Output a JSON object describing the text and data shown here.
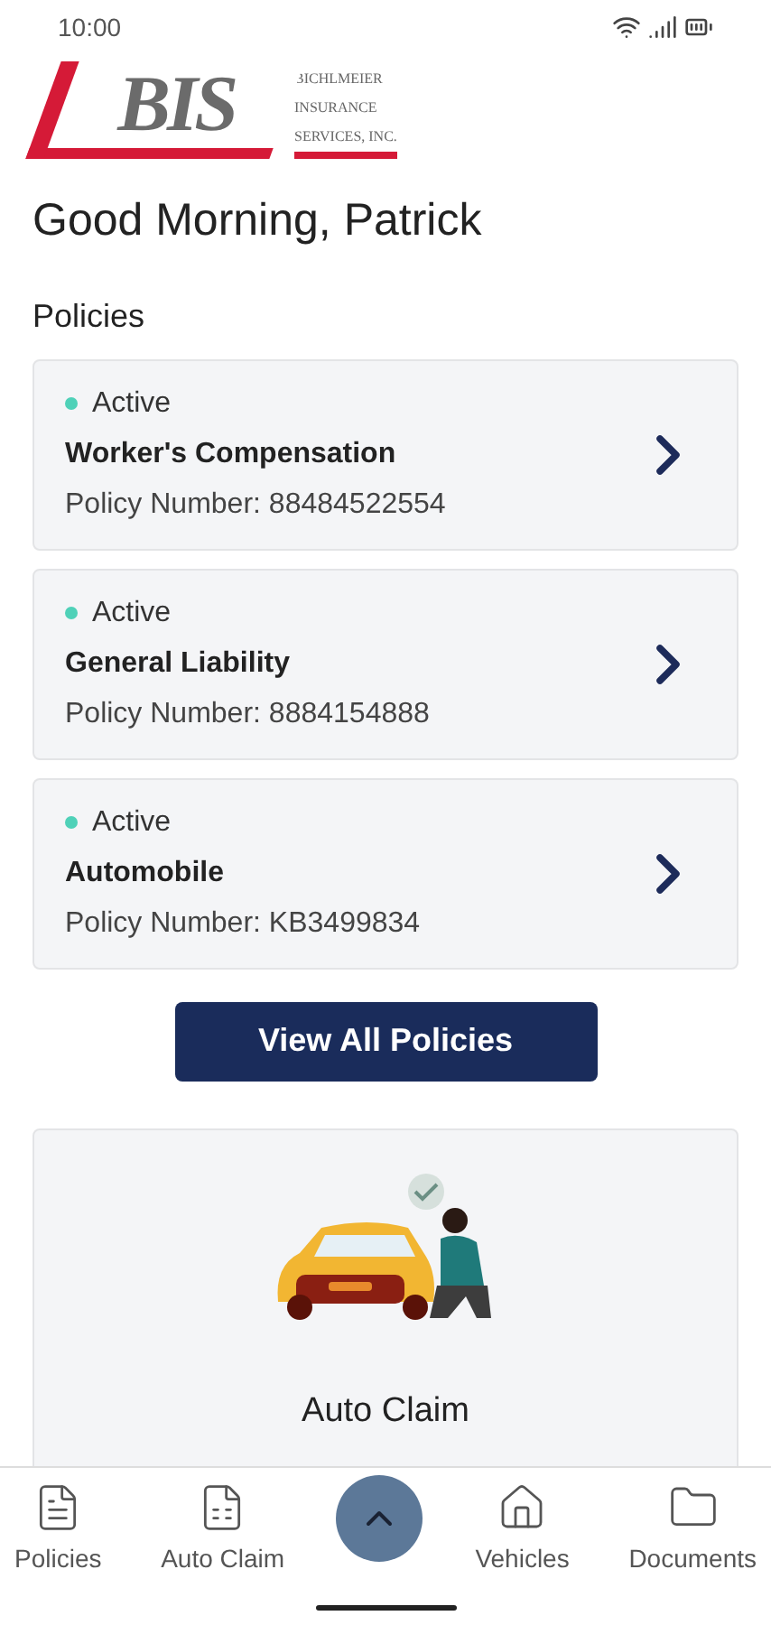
{
  "status_bar": {
    "time": "10:00"
  },
  "logo": {
    "mark": "BIS",
    "name_lines": [
      "BICHLMEIER",
      "INSURANCE",
      "SERVICES, INC."
    ]
  },
  "greeting": "Good Morning, Patrick",
  "policies_heading": "Policies",
  "policies": [
    {
      "status": "Active",
      "color": "#4fd1b8",
      "name": "Worker's Compensation",
      "number": "Policy Number: 88484522554"
    },
    {
      "status": "Active",
      "color": "#4fd1b8",
      "name": "General Liability",
      "number": "Policy Number: 8884154888"
    },
    {
      "status": "Active",
      "color": "#4fd1b8",
      "name": "Automobile",
      "number": "Policy Number: KB3499834"
    }
  ],
  "view_all_button": "View All Policies",
  "claim_card": {
    "kind": "picture",
    "title": "Auto Claim"
  },
  "bottom_nav": [
    {
      "kind": "policies",
      "label": "Policies"
    },
    {
      "kind": "claim",
      "label": "Auto Claim"
    },
    {
      "kind": "expand"
    },
    {
      "kind": "vehicles",
      "label": "Vehicles"
    },
    {
      "kind": "documents",
      "label": "Documents"
    }
  ]
}
